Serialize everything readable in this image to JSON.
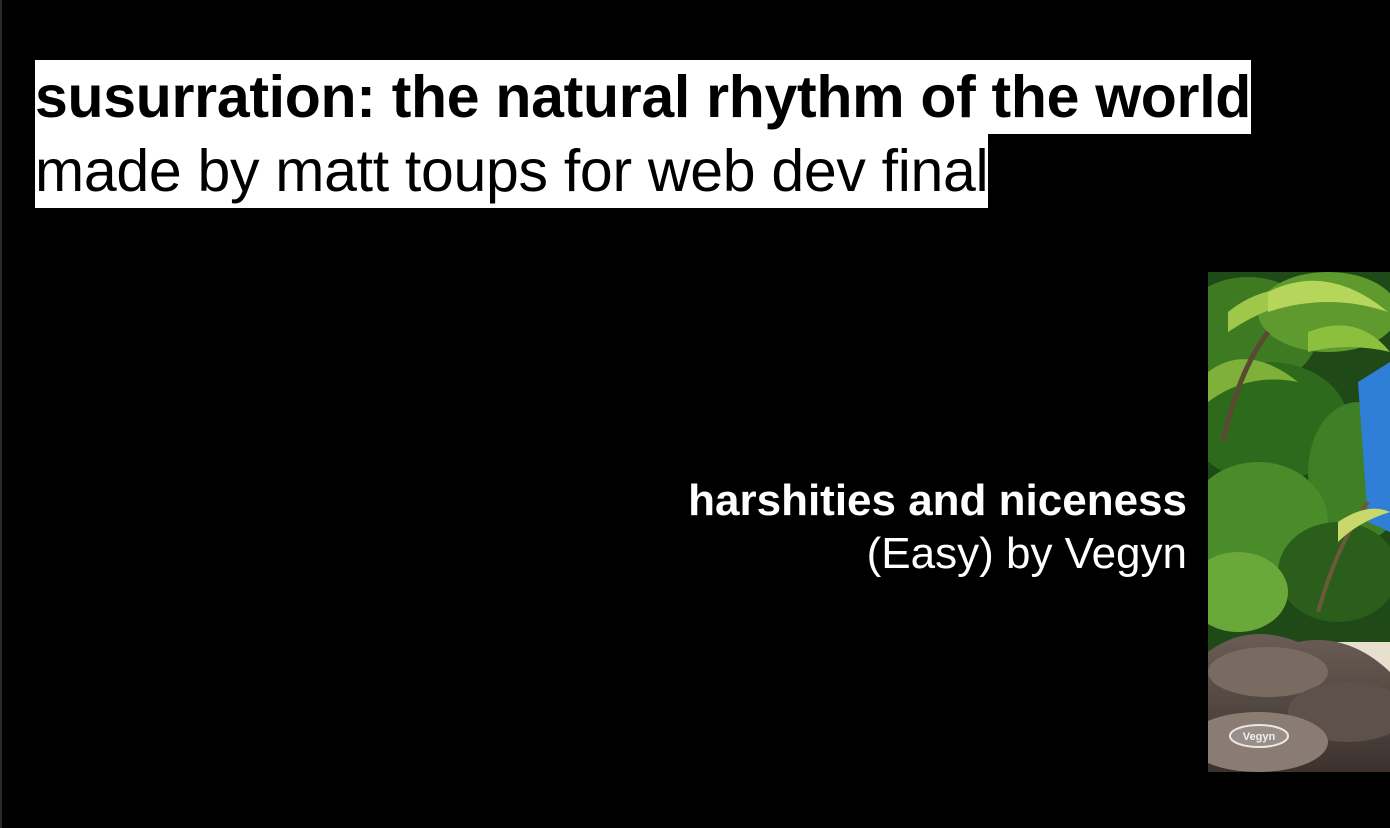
{
  "header": {
    "title": "susurration: the natural rhythm of the world",
    "subtitle": "made by matt toups for web dev final"
  },
  "now_playing": {
    "track_title": "harshities and niceness",
    "track_artist": "(Easy) by Vegyn",
    "cover_art_label": "Vegyn"
  },
  "colors": {
    "background": "#000000",
    "header_bg": "#ffffff",
    "header_text": "#000000",
    "track_text": "#ffffff"
  }
}
